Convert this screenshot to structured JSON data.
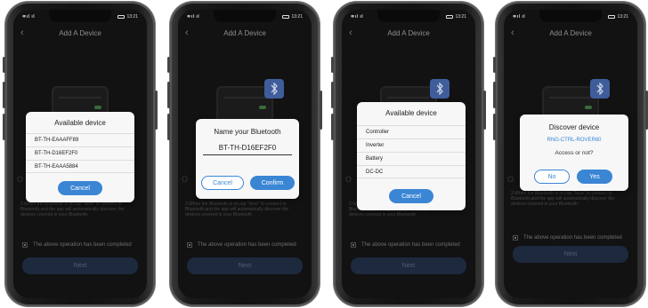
{
  "common": {
    "status_signal": "≑ıl ıl",
    "status_time": "13:21",
    "title": "Add A Device",
    "back_icon": "chevron-left-icon",
    "bg_heading": "O",
    "bg_instructions": "2.When the Bluetooth is on,tap \"Next\" to connect to Bluetooth,and the app will automatically discover the devices covered in your Bluetooth.",
    "checkbox_label": "The above operation has been completed",
    "next_label": "Next"
  },
  "phone1": {
    "dialog_title": "Available device",
    "devices": [
      "BT-TH-EAAAFF89",
      "BT-TH-D16EF2F0",
      "BT-TH-EAAA5884"
    ],
    "cancel_label": "Cancel"
  },
  "phone2": {
    "dialog_title": "Name your Bluetooth",
    "input_value": "BT-TH-D16EF2F0",
    "cancel_label": "Cancel",
    "confirm_label": "Confirm"
  },
  "phone3": {
    "dialog_title": "Available device",
    "devices": [
      "Controller",
      "Inverter",
      "Battery",
      "DC-DC"
    ],
    "cancel_label": "Cancel"
  },
  "phone4": {
    "dialog_title": "Discover device",
    "device_name": "RNG-CTRL-ROVER60",
    "question": "Access or not?",
    "no_label": "No",
    "yes_label": "Yes"
  },
  "colors": {
    "accent": "#3b86d4",
    "badge": "#3f5d9a",
    "screen_bg": "#1c1c1e",
    "next_button": "#2d3f5f"
  }
}
